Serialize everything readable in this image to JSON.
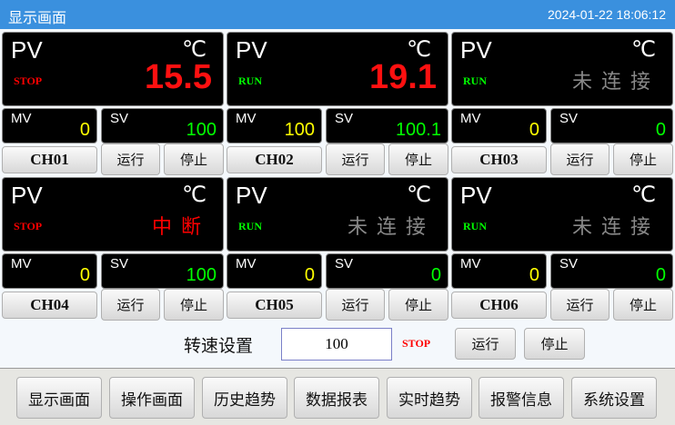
{
  "header": {
    "title": "显示画面",
    "datetime": "2024-01-22 18:06:12"
  },
  "labels": {
    "pv": "PV",
    "unit": "℃",
    "mv": "MV",
    "sv": "SV",
    "run": "运行",
    "stop": "停止"
  },
  "colors": {
    "title_bar": "#3a90de",
    "pv_value": "#ff1010",
    "stop": "#ff0000",
    "run": "#00ff00",
    "mv": "#ffff00",
    "sv": "#00ff00",
    "disconnected": "#888888"
  },
  "channels": [
    {
      "name": "CH01",
      "state": "STOP",
      "pv": "15.5",
      "mv": "0",
      "sv": "100"
    },
    {
      "name": "CH02",
      "state": "RUN",
      "pv": "19.1",
      "mv": "100",
      "sv": "100.1"
    },
    {
      "name": "CH03",
      "state": "RUN",
      "pv": "未连接",
      "mv": "0",
      "sv": "0"
    },
    {
      "name": "CH04",
      "state": "STOP",
      "pv": "中断",
      "mv": "0",
      "sv": "100"
    },
    {
      "name": "CH05",
      "state": "RUN",
      "pv": "未连接",
      "mv": "0",
      "sv": "0"
    },
    {
      "name": "CH06",
      "state": "RUN",
      "pv": "未连接",
      "mv": "0",
      "sv": "0"
    }
  ],
  "speed": {
    "label": "转速设置",
    "value": "100",
    "state": "STOP",
    "run": "运行",
    "stop": "停止"
  },
  "nav": [
    "显示画面",
    "操作画面",
    "历史趋势",
    "数据报表",
    "实时趋势",
    "报警信息",
    "系统设置"
  ]
}
